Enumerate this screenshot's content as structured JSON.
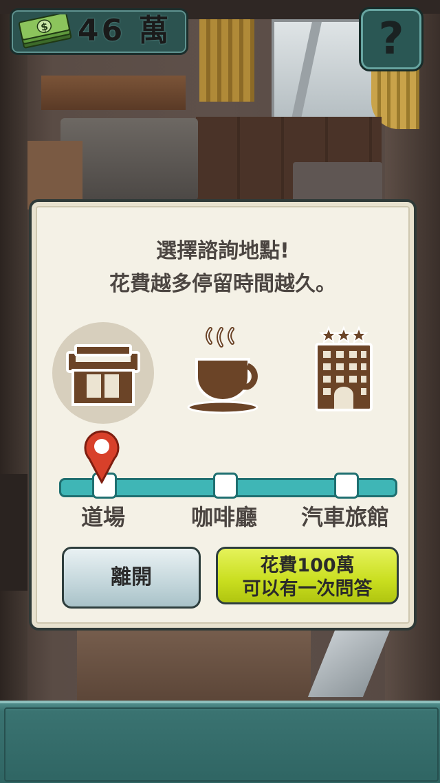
{
  "hud": {
    "money_value": "46 萬",
    "money_icon": "cash-bundle-icon",
    "help_label": "?"
  },
  "dialog": {
    "title_line1": "選擇諮詢地點!",
    "title_line2": "花費越多停留時間越久。",
    "locations": [
      {
        "label": "道場",
        "icon": "dojo-building-icon",
        "selected": true
      },
      {
        "label": "咖啡廳",
        "icon": "coffee-cup-icon",
        "selected": false
      },
      {
        "label": "汽車旅館",
        "icon": "three-star-hotel-icon",
        "selected": false
      }
    ],
    "selected_index": 0,
    "leave_button": "離開",
    "pay_button_line1": "花費100萬",
    "pay_button_line2": "可以有一次問答"
  },
  "colors": {
    "dialog_bg": "#f4f1e6",
    "icon_brown": "#6b4427",
    "track_teal": "#3fb6b6",
    "pin_red": "#d8402a",
    "pay_button": "#c9de1f",
    "leave_button": "#c3d6db",
    "hud_teal": "#2c5350"
  }
}
